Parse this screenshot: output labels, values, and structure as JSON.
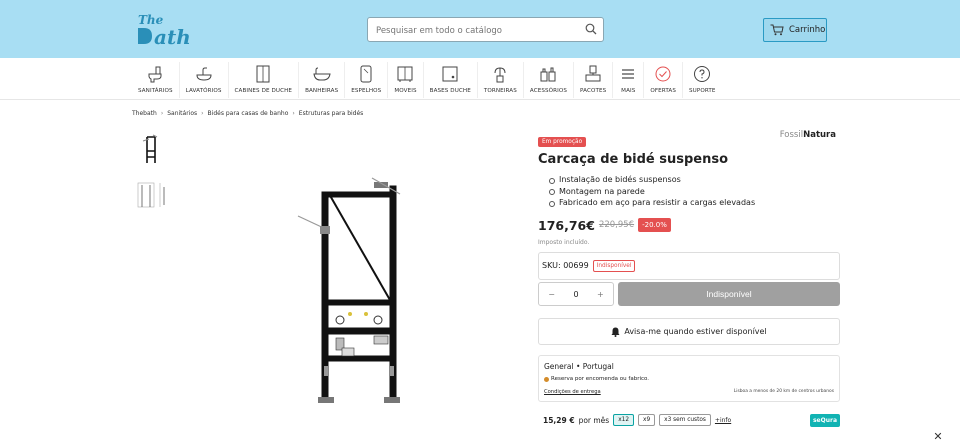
{
  "header": {
    "search_placeholder": "Pesquisar em todo o catálogo",
    "cart_label": "Carrinho",
    "accent_color": "#a8def3"
  },
  "nav": {
    "items": [
      {
        "label": "SANITÁRIOS",
        "icon": "toilet-icon"
      },
      {
        "label": "LAVATÓRIOS",
        "icon": "washbasin-icon"
      },
      {
        "label": "CABINES DE DUCHE",
        "icon": "shower-cabin-icon"
      },
      {
        "label": "BANHEIRAS",
        "icon": "bathtub-icon"
      },
      {
        "label": "ESPELHOS",
        "icon": "mirror-icon"
      },
      {
        "label": "MOVEIS",
        "icon": "cabinet-icon"
      },
      {
        "label": "BASES DUCHE",
        "icon": "shower-tray-icon"
      },
      {
        "label": "TORNEIRAS",
        "icon": "faucet-icon"
      },
      {
        "label": "ACESSÓRIOS",
        "icon": "accessories-icon"
      },
      {
        "label": "PACOTES",
        "icon": "bundle-icon"
      },
      {
        "label": "MAIS",
        "icon": "menu-icon"
      },
      {
        "label": "OFERTAS",
        "icon": "offers-icon"
      },
      {
        "label": "SUPORTE",
        "icon": "support-icon"
      }
    ]
  },
  "breadcrumb": [
    "Thebath",
    "Sanitários",
    "Bidés para casas de banho",
    "Estruturas para bidés"
  ],
  "product": {
    "promo_badge": "Em promoção",
    "brand_prefix": "Fossil",
    "brand_name": "Natura",
    "title": "Carcaça de bidé suspenso",
    "features": [
      "Instalação de bidés suspensos",
      "Montagem na parede",
      "Fabricado em aço para resistir a cargas elevadas"
    ],
    "price": "176,76€",
    "old_price": "220,95€",
    "discount": "-20.0%",
    "tax_note": "Imposto incluído.",
    "sku": "SKU: 00699",
    "sku_status": "Indisponível",
    "quantity": "0",
    "buy_button": "Indisponível",
    "notify_label": "Avisa-me quando estiver disponível"
  },
  "stock": {
    "location": "General • Portugal",
    "reservation": "Reserva por encomenda ou fabrico.",
    "conditions_link": "Condições de entrega",
    "distance_note": "Lisboa a menos de 20 km de centros urbanos"
  },
  "financing": {
    "monthly_amount": "15,29 €",
    "monthly_suffix": "por mês",
    "options": [
      "x12",
      "x9",
      "x3 sem custos"
    ],
    "selected": "x12",
    "more_info": "+info",
    "provider": "seQura",
    "provider_color": "#11b3b3"
  }
}
